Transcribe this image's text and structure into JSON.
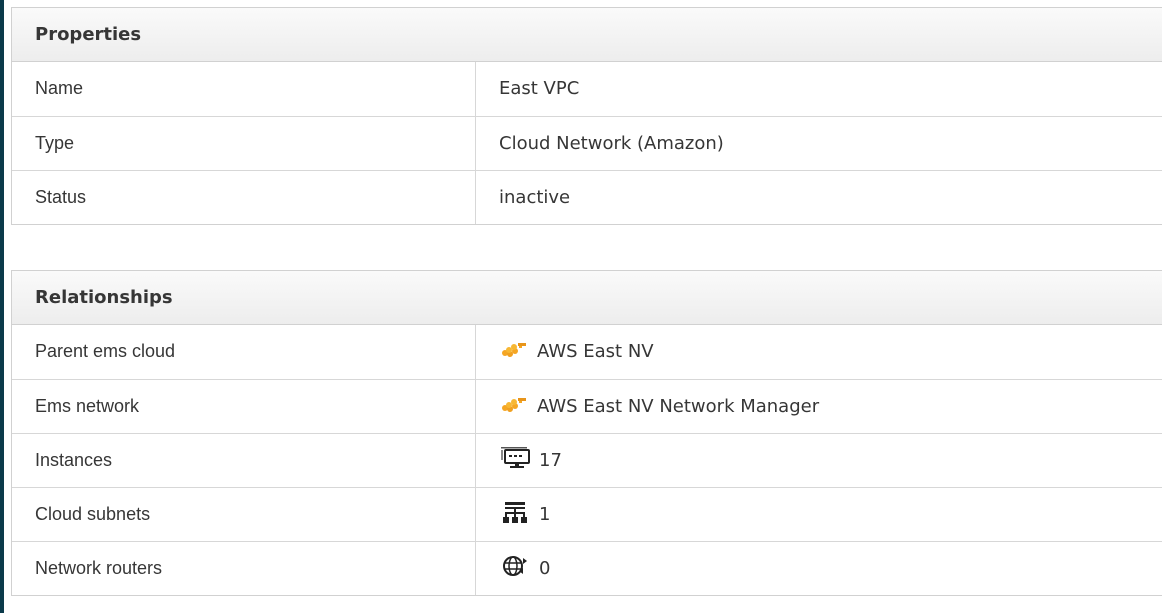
{
  "properties": {
    "title": "Properties",
    "rows": [
      {
        "label": "Name",
        "value": "East VPC"
      },
      {
        "label": "Type",
        "value": "Cloud Network (Amazon)"
      },
      {
        "label": "Status",
        "value": "inactive"
      }
    ]
  },
  "relationships": {
    "title": "Relationships",
    "rows": [
      {
        "label": "Parent ems cloud",
        "value": "AWS East NV",
        "icon": "aws-cloud-icon"
      },
      {
        "label": "Ems network",
        "value": "AWS East NV Network Manager",
        "icon": "aws-cloud-icon"
      },
      {
        "label": "Instances",
        "value": "17",
        "icon": "instance-monitor-icon"
      },
      {
        "label": "Cloud subnets",
        "value": "1",
        "icon": "subnet-tree-icon"
      },
      {
        "label": "Network routers",
        "value": "0",
        "icon": "router-globe-icon"
      }
    ]
  },
  "colors": {
    "header_bg": "#ededed",
    "border": "#d1d1d1",
    "aws_orange": "#f5a623",
    "text": "#363636"
  }
}
